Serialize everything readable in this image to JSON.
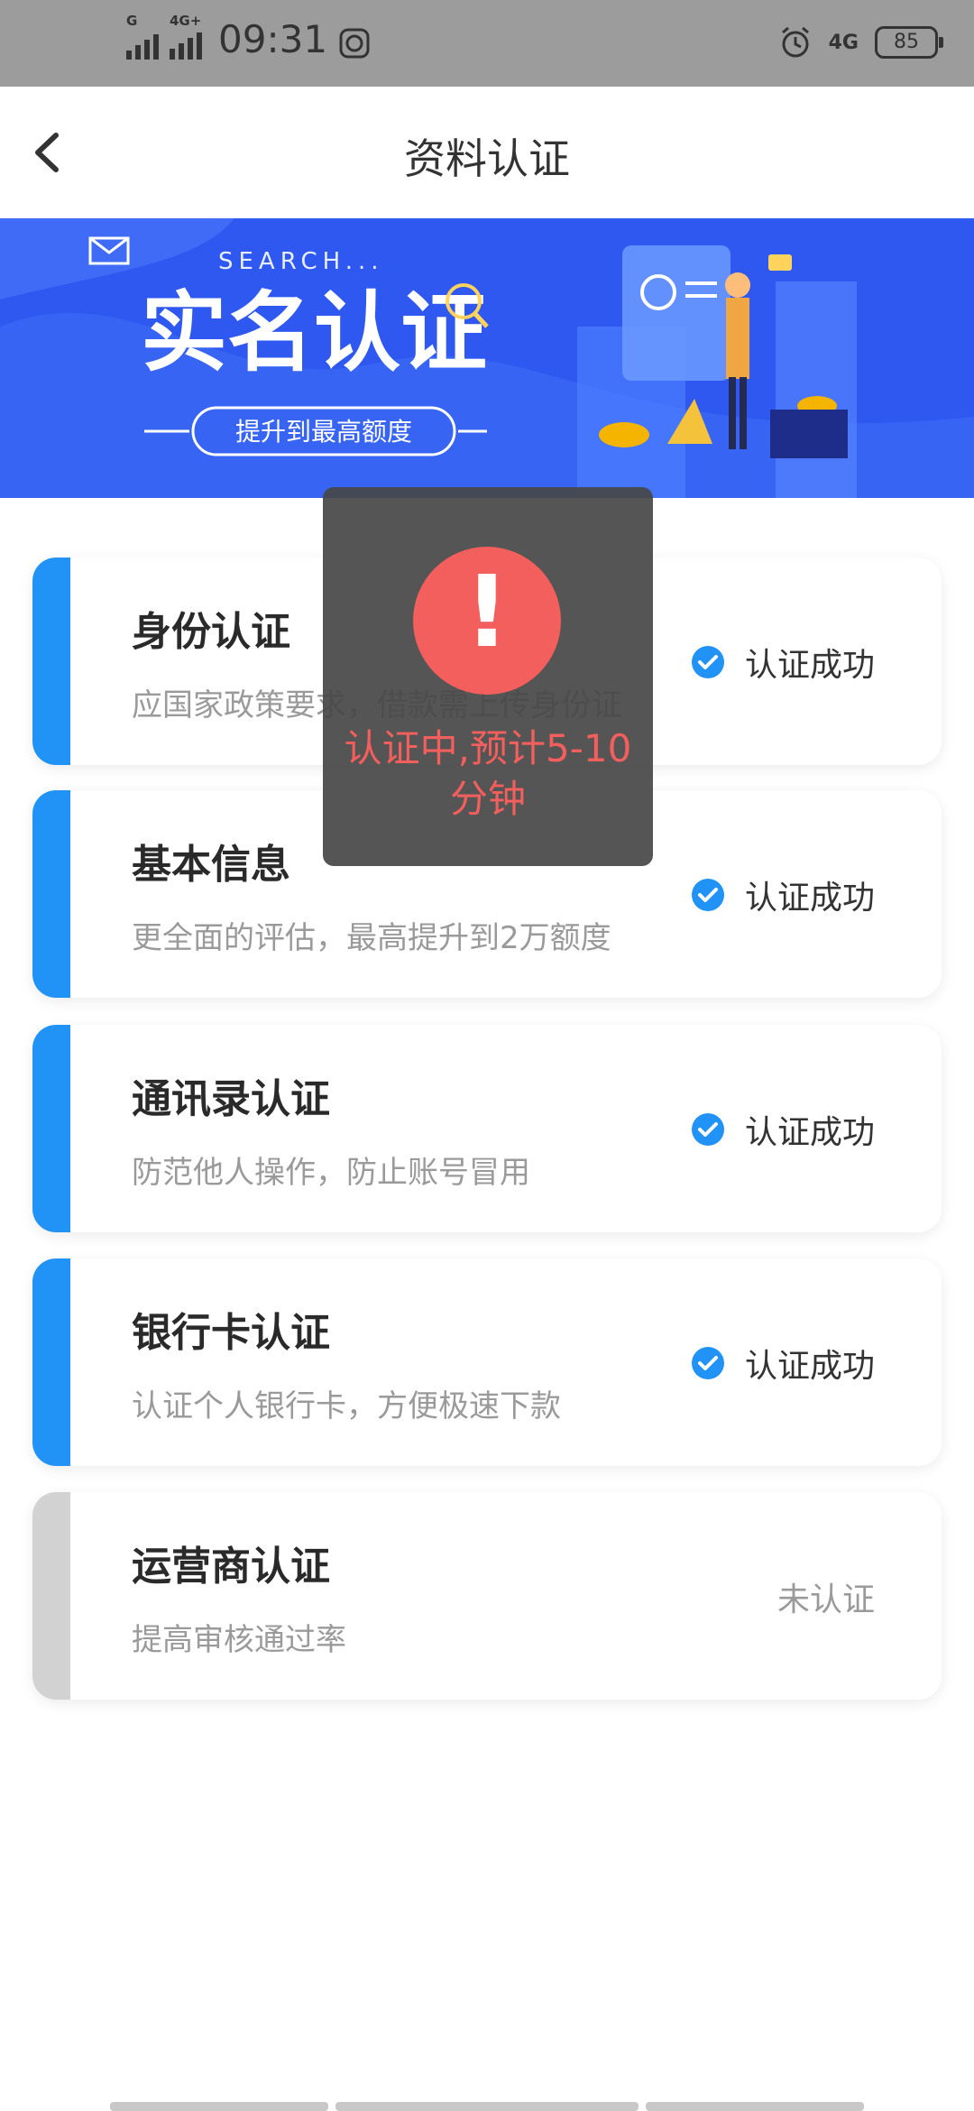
{
  "status_bar": {
    "network_left": "G",
    "network_4g": "4G+",
    "time": "09:31",
    "network_right": "4G",
    "battery": "85"
  },
  "header": {
    "title": "资料认证"
  },
  "banner": {
    "search": "SEARCH...",
    "headline": "实名认证",
    "button": "提升到最高额度"
  },
  "cards": [
    {
      "title": "身份认证",
      "subtitle": "应国家政策要求，借款需上传身份证",
      "status": "认证成功",
      "verified": true
    },
    {
      "title": "基本信息",
      "subtitle": "更全面的评估，最高提升到2万额度",
      "status": "认证成功",
      "verified": true
    },
    {
      "title": "通讯录认证",
      "subtitle": "防范他人操作，防止账号冒用",
      "status": "认证成功",
      "verified": true
    },
    {
      "title": "银行卡认证",
      "subtitle": "认证个人银行卡，方便极速下款",
      "status": "认证成功",
      "verified": true
    },
    {
      "title": "运营商认证",
      "subtitle": "提高审核通过率",
      "status": "未认证",
      "verified": false
    }
  ],
  "toast": {
    "icon": "!",
    "message": "认证中,预计5-10分钟"
  },
  "colors": {
    "accent": "#2193f6",
    "banner": "#2e58f0",
    "alert": "#f35f5c"
  }
}
